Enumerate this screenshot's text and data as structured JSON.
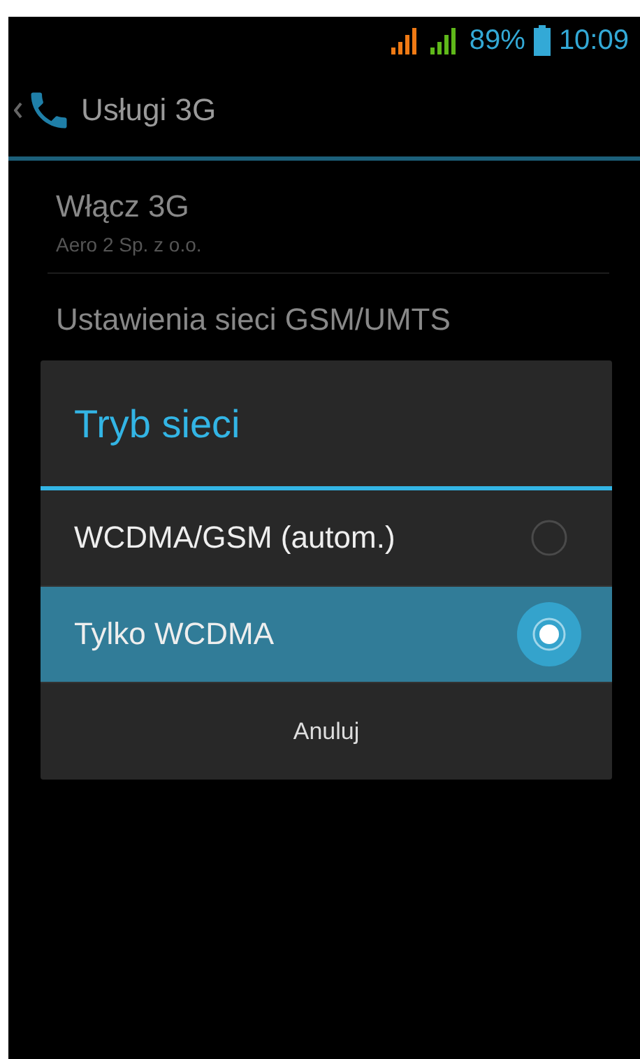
{
  "status_bar": {
    "battery": "89%",
    "time": "10:09"
  },
  "action_bar": {
    "title": "Usługi 3G"
  },
  "settings": [
    {
      "title": "Włącz 3G",
      "summary": "Aero 2 Sp. z o.o."
    },
    {
      "title": "Ustawienia sieci GSM/UMTS"
    }
  ],
  "dialog": {
    "title": "Tryb sieci",
    "options": [
      {
        "label": "WCDMA/GSM (autom.)",
        "selected": false
      },
      {
        "label": "Tylko WCDMA",
        "selected": true
      }
    ],
    "cancel": "Anuluj"
  }
}
